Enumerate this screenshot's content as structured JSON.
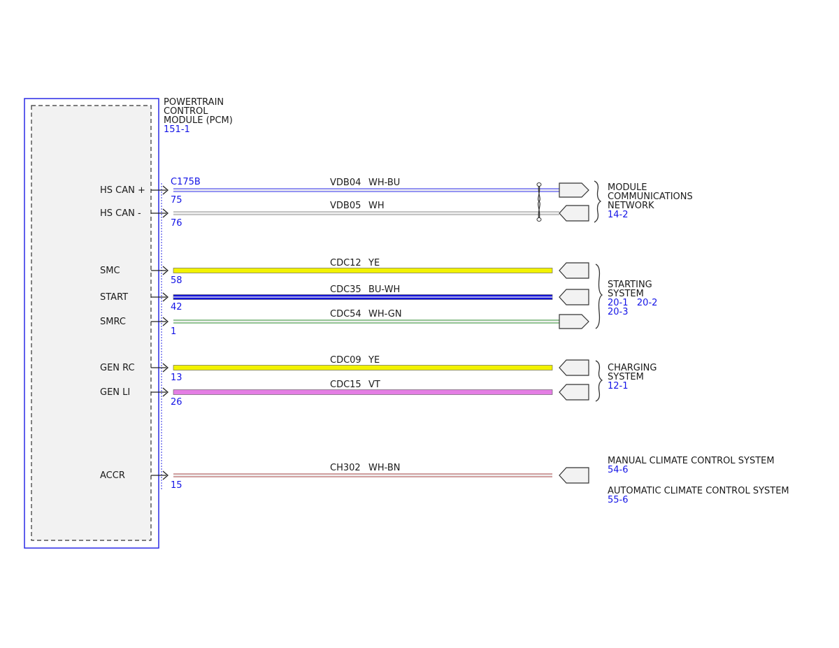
{
  "module": {
    "name_lines": [
      "POWERTRAIN",
      "CONTROL",
      "MODULE (PCM)"
    ],
    "ref": "151-1",
    "connector": "C175B",
    "colors": {
      "border": "#2a2ae6",
      "fill": "#f2f2f2"
    }
  },
  "circuits": [
    {
      "signal": "HS CAN +",
      "pin": "75",
      "circuit": "VDB04",
      "color_code": "WH-BU",
      "wire_colors": [
        "#2a2ae6",
        "#ffffff"
      ]
    },
    {
      "signal": "HS CAN -",
      "pin": "76",
      "circuit": "VDB05",
      "color_code": "WH",
      "wire_colors": [
        "#888888",
        "#ffffff"
      ]
    },
    {
      "signal": "SMC",
      "pin": "58",
      "circuit": "CDC12",
      "color_code": "YE",
      "wire_colors": [
        "#f2f200",
        "#f2f200"
      ]
    },
    {
      "signal": "START",
      "pin": "42",
      "circuit": "CDC35",
      "color_code": "BU-WH",
      "wire_colors": [
        "#1414d6",
        "#ffffff"
      ]
    },
    {
      "signal": "SMRC",
      "pin": "1",
      "circuit": "CDC54",
      "color_code": "WH-GN",
      "wire_colors": [
        "#2e8b2e",
        "#ffffff"
      ]
    },
    {
      "signal": "GEN RC",
      "pin": "13",
      "circuit": "CDC09",
      "color_code": "YE",
      "wire_colors": [
        "#f2f200",
        "#f2f200"
      ]
    },
    {
      "signal": "GEN LI",
      "pin": "26",
      "circuit": "CDC15",
      "color_code": "VT",
      "wire_colors": [
        "#e47ee4",
        "#e47ee4"
      ]
    },
    {
      "signal": "ACCR",
      "pin": "15",
      "circuit": "CH302",
      "color_code": "WH-BN",
      "wire_colors": [
        "#a04040",
        "#ffffff"
      ]
    }
  ],
  "destinations": [
    {
      "name_lines": [
        "MODULE",
        "COMMUNICATIONS",
        "NETWORK"
      ],
      "refs": [
        "14-2"
      ]
    },
    {
      "name_lines": [
        "STARTING",
        "SYSTEM"
      ],
      "refs": [
        "20-1   20-2",
        "20-3"
      ]
    },
    {
      "name_lines": [
        "CHARGING",
        "SYSTEM"
      ],
      "refs": [
        "12-1"
      ]
    },
    {
      "name_lines": [
        "MANUAL CLIMATE CONTROL SYSTEM"
      ],
      "refs": [
        "54-6"
      ]
    },
    {
      "name_lines": [
        "AUTOMATIC CLIMATE CONTROL SYSTEM"
      ],
      "refs": [
        "55-6"
      ]
    }
  ],
  "theme": {
    "text": "#1a1a1a",
    "ref_blue": "#1414e6",
    "connector_fill": "#f2f2f2"
  }
}
